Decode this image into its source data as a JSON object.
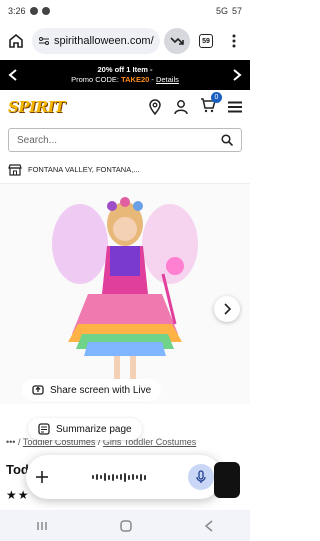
{
  "status": {
    "time": "3:26",
    "network": "5G",
    "battery": "57"
  },
  "browser": {
    "url": "spirithalloween.com/",
    "tab_count": "59"
  },
  "promo": {
    "line1": "20% off 1 Item -",
    "code_prefix": "Promo CODE: ",
    "code": "TAKE20",
    "separator": " - ",
    "details": "Details"
  },
  "site": {
    "logo": "SPIRIT",
    "cart_count": "0"
  },
  "search": {
    "placeholder": "Search..."
  },
  "store": {
    "name": "FONTANA VALLEY, FONTANA,..."
  },
  "overlay": {
    "share_label": "Share screen with Live",
    "summarize_label": "Summarize page"
  },
  "breadcrumb": {
    "ellipsis": "•••",
    "item1": "Toddler Costumes",
    "item2": "Girls Toddler Costumes"
  },
  "product": {
    "title_partial": "Tod",
    "stars": "★★"
  },
  "colors": {
    "promo_code": "#ff8a1a",
    "logo": "#f2b600",
    "badge": "#1a5fbf"
  }
}
